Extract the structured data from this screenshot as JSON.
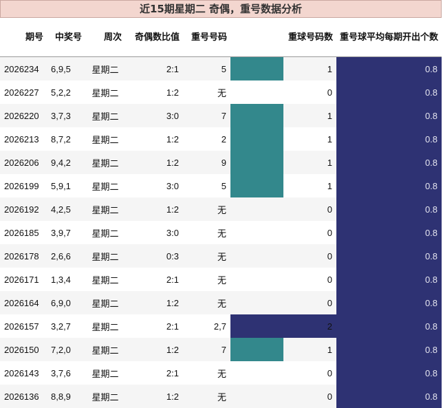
{
  "title": "近15期星期二 奇偶，重号数据分析",
  "colors": {
    "teal": "#33888c",
    "navy": "#2e3273",
    "title_bg": "#f3d6cf"
  },
  "headers": [
    "期号",
    "中奖号",
    "周次",
    "奇偶数比值",
    "重号号码",
    "",
    "重球号码数",
    "重号球平均每期开出个数"
  ],
  "max_count": 2,
  "rows": [
    {
      "qihao": "2026234",
      "zj": "6,9,5",
      "zhou": "星期二",
      "ratio": "2:1",
      "chong": "5",
      "count": 1,
      "count_label": "1",
      "avg": "0.8"
    },
    {
      "qihao": "2026227",
      "zj": "5,2,2",
      "zhou": "星期二",
      "ratio": "1:2",
      "chong": "无",
      "count": 0,
      "count_label": "0",
      "avg": "0.8"
    },
    {
      "qihao": "2026220",
      "zj": "3,7,3",
      "zhou": "星期二",
      "ratio": "3:0",
      "chong": "7",
      "count": 1,
      "count_label": "1",
      "avg": "0.8"
    },
    {
      "qihao": "2026213",
      "zj": "8,7,2",
      "zhou": "星期二",
      "ratio": "1:2",
      "chong": "2",
      "count": 1,
      "count_label": "1",
      "avg": "0.8"
    },
    {
      "qihao": "2026206",
      "zj": "9,4,2",
      "zhou": "星期二",
      "ratio": "1:2",
      "chong": "9",
      "count": 1,
      "count_label": "1",
      "avg": "0.8"
    },
    {
      "qihao": "2026199",
      "zj": "5,9,1",
      "zhou": "星期二",
      "ratio": "3:0",
      "chong": "5",
      "count": 1,
      "count_label": "1",
      "avg": "0.8"
    },
    {
      "qihao": "2026192",
      "zj": "4,2,5",
      "zhou": "星期二",
      "ratio": "1:2",
      "chong": "无",
      "count": 0,
      "count_label": "0",
      "avg": "0.8"
    },
    {
      "qihao": "2026185",
      "zj": "3,9,7",
      "zhou": "星期二",
      "ratio": "3:0",
      "chong": "无",
      "count": 0,
      "count_label": "0",
      "avg": "0.8"
    },
    {
      "qihao": "2026178",
      "zj": "2,6,6",
      "zhou": "星期二",
      "ratio": "0:3",
      "chong": "无",
      "count": 0,
      "count_label": "0",
      "avg": "0.8"
    },
    {
      "qihao": "2026171",
      "zj": "1,3,4",
      "zhou": "星期二",
      "ratio": "2:1",
      "chong": "无",
      "count": 0,
      "count_label": "0",
      "avg": "0.8"
    },
    {
      "qihao": "2026164",
      "zj": "6,9,0",
      "zhou": "星期二",
      "ratio": "1:2",
      "chong": "无",
      "count": 0,
      "count_label": "0",
      "avg": "0.8"
    },
    {
      "qihao": "2026157",
      "zj": "3,2,7",
      "zhou": "星期二",
      "ratio": "2:1",
      "chong": "2,7",
      "count": 2,
      "count_label": "2",
      "avg": "0.8"
    },
    {
      "qihao": "2026150",
      "zj": "7,2,0",
      "zhou": "星期二",
      "ratio": "1:2",
      "chong": "7",
      "count": 1,
      "count_label": "1",
      "avg": "0.8"
    },
    {
      "qihao": "2026143",
      "zj": "3,7,6",
      "zhou": "星期二",
      "ratio": "2:1",
      "chong": "无",
      "count": 0,
      "count_label": "0",
      "avg": "0.8"
    },
    {
      "qihao": "2026136",
      "zj": "8,8,9",
      "zhou": "星期二",
      "ratio": "1:2",
      "chong": "无",
      "count": 0,
      "count_label": "0",
      "avg": "0.8"
    }
  ]
}
